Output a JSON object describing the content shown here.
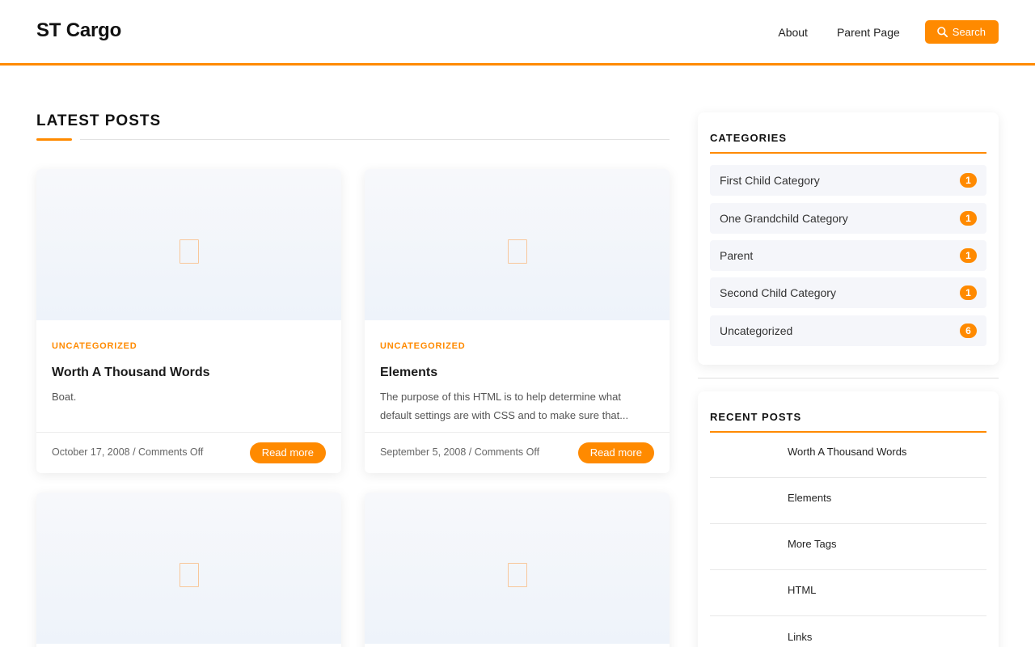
{
  "header": {
    "logo": "ST Cargo",
    "nav": [
      {
        "label": "About"
      },
      {
        "label": "Parent Page"
      }
    ],
    "search_label": "Search"
  },
  "main": {
    "section_title": "LATEST POSTS",
    "posts": [
      {
        "category": "UNCATEGORIZED",
        "title": "Worth A Thousand Words",
        "excerpt": "Boat.",
        "meta": "October 17, 2008 / Comments Off",
        "read_more": "Read more"
      },
      {
        "category": "UNCATEGORIZED",
        "title": "Elements",
        "excerpt": "The purpose of this HTML is to help determine what default settings are with CSS and to make sure that...",
        "meta": "September 5, 2008 / Comments Off",
        "read_more": "Read more"
      }
    ]
  },
  "sidebar": {
    "categories": {
      "title": "CATEGORIES",
      "items": [
        {
          "label": "First Child Category",
          "count": "1"
        },
        {
          "label": "One Grandchild Category",
          "count": "1"
        },
        {
          "label": "Parent",
          "count": "1"
        },
        {
          "label": "Second Child Category",
          "count": "1"
        },
        {
          "label": "Uncategorized",
          "count": "6"
        }
      ]
    },
    "recent_posts": {
      "title": "RECENT POSTS",
      "items": [
        {
          "label": "Worth A Thousand Words"
        },
        {
          "label": "Elements"
        },
        {
          "label": "More Tags"
        },
        {
          "label": "HTML"
        },
        {
          "label": "Links"
        }
      ]
    }
  },
  "colors": {
    "accent": "#ff8a00"
  },
  "icons": {
    "search": "search-icon",
    "thumbnail": "image-placeholder-icon"
  }
}
